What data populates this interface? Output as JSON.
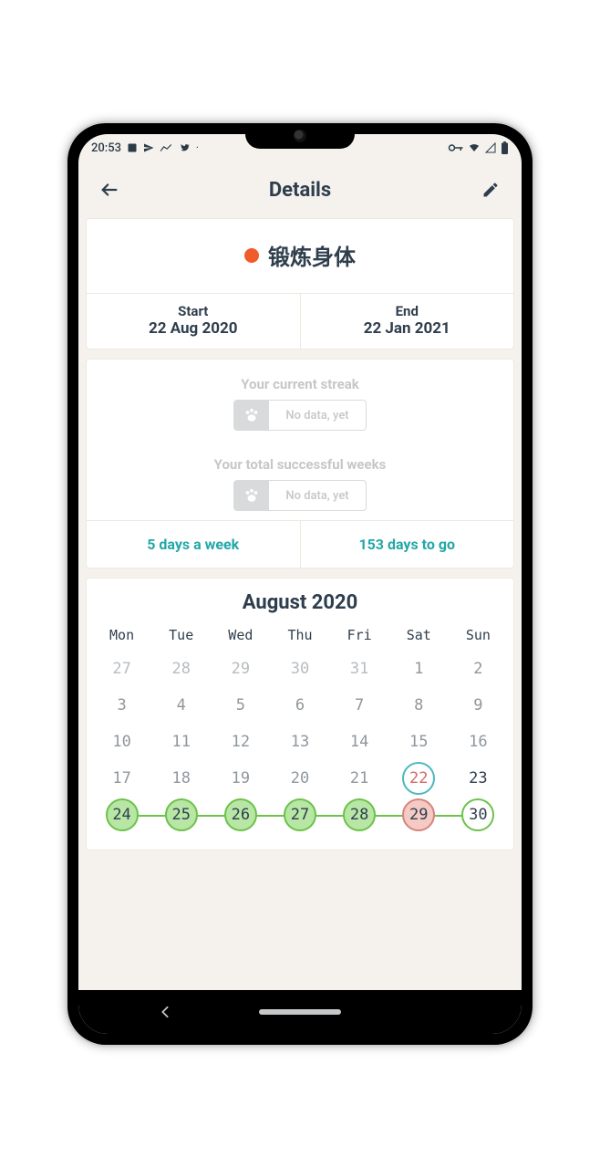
{
  "status": {
    "time": "20:53"
  },
  "appbar": {
    "title": "Details"
  },
  "habit": {
    "name": "锻炼身体",
    "dot_color": "#f15a29",
    "start_label": "Start",
    "start_value": "22 Aug 2020",
    "end_label": "End",
    "end_value": "22 Jan 2021"
  },
  "streak": {
    "current_label": "Your current streak",
    "current_value": "No data, yet",
    "total_label": "Your total successful weeks",
    "total_value": "No data, yet"
  },
  "summary": {
    "frequency": "5 days a week",
    "remaining": "153 days to go"
  },
  "calendar": {
    "month": "August 2020",
    "weekdays": [
      "Mon",
      "Tue",
      "Wed",
      "Thu",
      "Fri",
      "Sat",
      "Sun"
    ],
    "rows": [
      [
        {
          "n": "27",
          "cls": "other"
        },
        {
          "n": "28",
          "cls": "other"
        },
        {
          "n": "29",
          "cls": "other"
        },
        {
          "n": "30",
          "cls": "other"
        },
        {
          "n": "31",
          "cls": "other"
        },
        {
          "n": "1",
          "cls": "muted"
        },
        {
          "n": "2",
          "cls": "muted"
        }
      ],
      [
        {
          "n": "3",
          "cls": "muted"
        },
        {
          "n": "4",
          "cls": "muted"
        },
        {
          "n": "5",
          "cls": "muted"
        },
        {
          "n": "6",
          "cls": "muted"
        },
        {
          "n": "7",
          "cls": "muted"
        },
        {
          "n": "8",
          "cls": "muted"
        },
        {
          "n": "9",
          "cls": "muted"
        }
      ],
      [
        {
          "n": "10",
          "cls": "muted"
        },
        {
          "n": "11",
          "cls": "muted"
        },
        {
          "n": "12",
          "cls": "muted"
        },
        {
          "n": "13",
          "cls": "muted"
        },
        {
          "n": "14",
          "cls": "muted"
        },
        {
          "n": "15",
          "cls": "muted"
        },
        {
          "n": "16",
          "cls": "muted"
        }
      ],
      [
        {
          "n": "17",
          "cls": "muted"
        },
        {
          "n": "18",
          "cls": "muted"
        },
        {
          "n": "19",
          "cls": "muted"
        },
        {
          "n": "20",
          "cls": "muted"
        },
        {
          "n": "21",
          "cls": "muted"
        },
        {
          "n": "22",
          "cls": "ring-teal"
        },
        {
          "n": "23",
          "cls": ""
        }
      ],
      [
        {
          "n": "24",
          "cls": "fill-green"
        },
        {
          "n": "25",
          "cls": "fill-green"
        },
        {
          "n": "26",
          "cls": "fill-green"
        },
        {
          "n": "27",
          "cls": "fill-green"
        },
        {
          "n": "28",
          "cls": "fill-green"
        },
        {
          "n": "29",
          "cls": "fill-red"
        },
        {
          "n": "30",
          "cls": "ring-green"
        }
      ]
    ]
  }
}
